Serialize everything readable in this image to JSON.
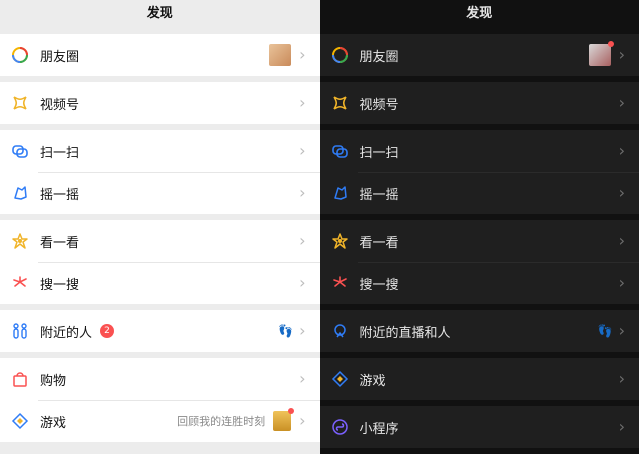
{
  "light_panel": {
    "title": "发现",
    "items": [
      {
        "label": "朋友圈"
      },
      {
        "label": "视频号"
      },
      {
        "label": "扫一扫"
      },
      {
        "label": "摇一摇"
      },
      {
        "label": "看一看"
      },
      {
        "label": "搜一搜"
      },
      {
        "label": "附近的人",
        "badge": "2"
      },
      {
        "label": "购物"
      },
      {
        "label": "游戏",
        "subtext": "回顾我的连胜时刻"
      }
    ]
  },
  "dark_panel": {
    "title": "发现",
    "items": [
      {
        "label": "朋友圈"
      },
      {
        "label": "视频号"
      },
      {
        "label": "扫一扫"
      },
      {
        "label": "摇一摇"
      },
      {
        "label": "看一看"
      },
      {
        "label": "搜一搜"
      },
      {
        "label": "附近的直播和人"
      },
      {
        "label": "游戏"
      },
      {
        "label": "小程序"
      }
    ]
  },
  "icons": {
    "moments": "moments-icon",
    "channels": "channels-icon",
    "scan": "scan-icon",
    "shake": "shake-icon",
    "top_stories": "top-stories-icon",
    "search": "search-icon",
    "nearby": "nearby-people-icon",
    "shopping": "shopping-bag-icon",
    "games": "games-icon",
    "mini_programs": "mini-programs-icon",
    "chevron": "chevron-right-icon",
    "footprint": "footprint-icon"
  },
  "colors": {
    "light_bg": "#ececec",
    "dark_bg": "#111111",
    "badge": "#fa5151",
    "channels": "#f0b429",
    "scan": "#2f7cf6",
    "search": "#fa5151",
    "nearby": "#2f7cf6",
    "shopping": "#fa5151",
    "mini_program": "#7b61ff"
  }
}
